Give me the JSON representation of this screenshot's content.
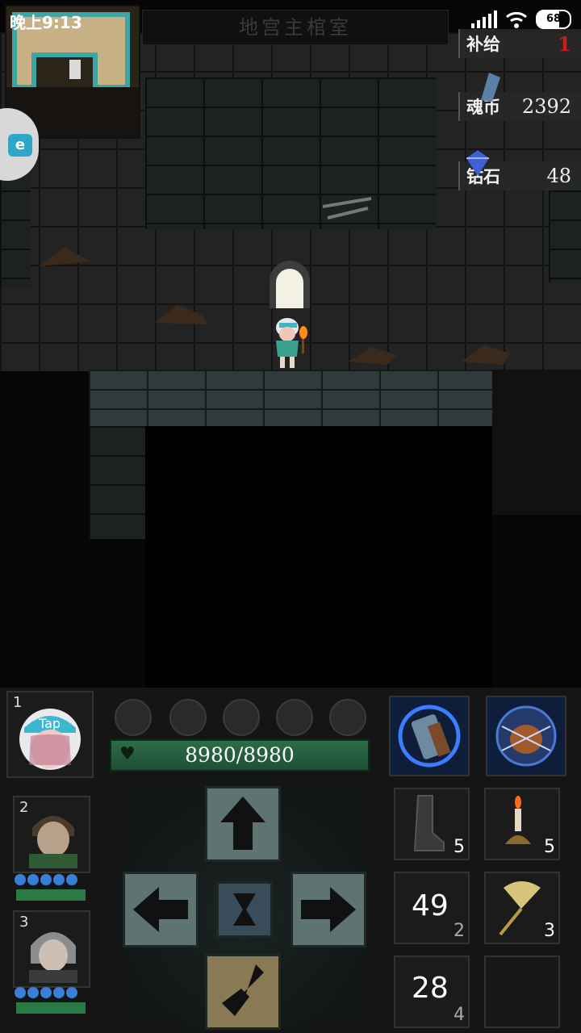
{
  "status_bar": {
    "time": "晚上9:13",
    "battery": "68"
  },
  "room": {
    "title": "地宫主棺室"
  },
  "resources": [
    {
      "label": "补给",
      "value": "1",
      "color": "#c81e1e"
    },
    {
      "label": "魂币",
      "value": "2392"
    },
    {
      "label": "钻石",
      "value": "48"
    }
  ],
  "party": {
    "leader": {
      "slot": "1",
      "hp_text": "8980/8980",
      "hp_fraction": 1.0,
      "energy_orbs": 5
    },
    "members": [
      {
        "slot": "2"
      },
      {
        "slot": "3"
      }
    ]
  },
  "items": [
    {
      "name": "boot",
      "count": "5"
    },
    {
      "name": "candle",
      "count": "5"
    },
    {
      "name": "stack-a",
      "big": "49",
      "count": "2"
    },
    {
      "name": "fan",
      "count": "3"
    },
    {
      "name": "stack-b",
      "big": "28",
      "count": "4"
    }
  ],
  "colors": {
    "hp": "#2d6c49",
    "accent": "#3a7ed6"
  }
}
